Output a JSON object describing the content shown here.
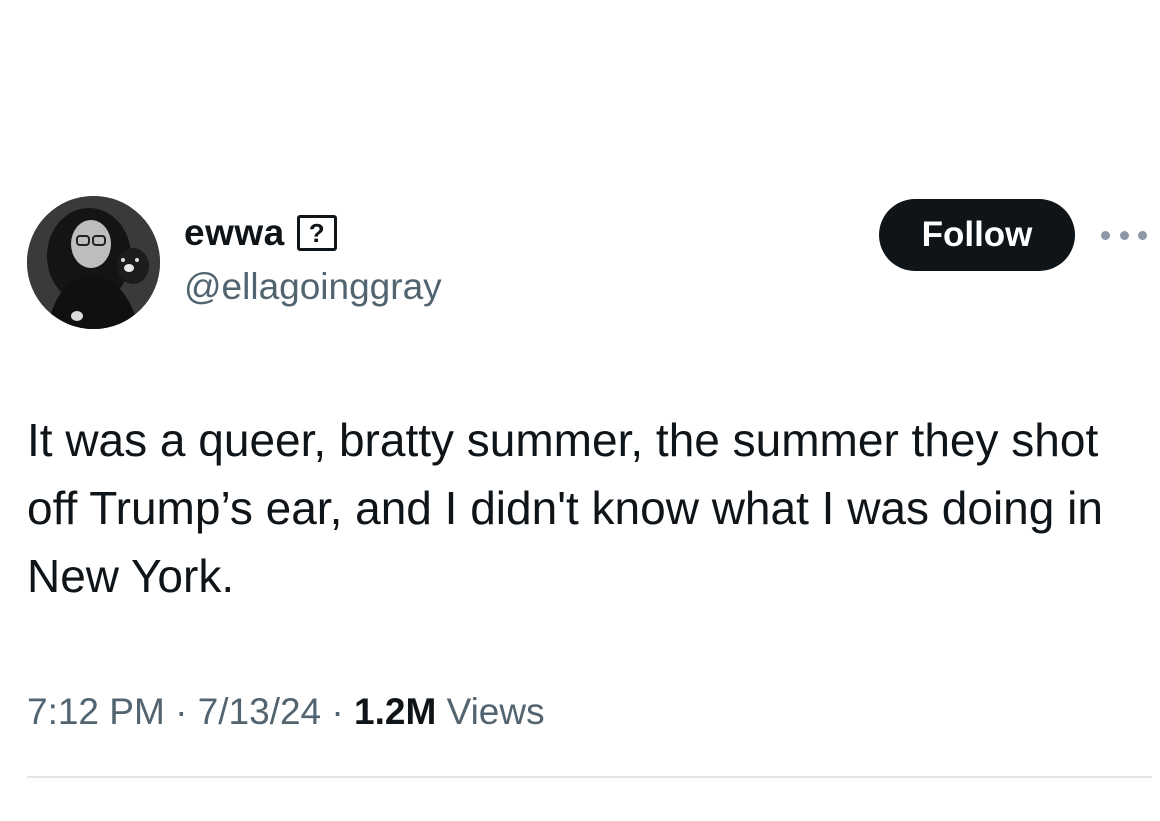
{
  "user": {
    "display_name": "ewwa",
    "unknown_glyph": "?",
    "handle": "@ellagoinggray"
  },
  "actions": {
    "follow_label": "Follow",
    "more_icon": "more-horizontal-icon"
  },
  "tweet": {
    "text": "It was a queer, bratty summer, the summer they shot off Trump’s ear, and I didn't know what I was doing in New York."
  },
  "meta": {
    "time": "7:12 PM",
    "separator": "·",
    "date": "7/13/24",
    "views_count": "1.2M",
    "views_label": "Views"
  },
  "colors": {
    "text_primary": "#0f1419",
    "text_secondary": "#536471",
    "button_bg": "#0f1419",
    "divider": "#e3e6e8"
  }
}
